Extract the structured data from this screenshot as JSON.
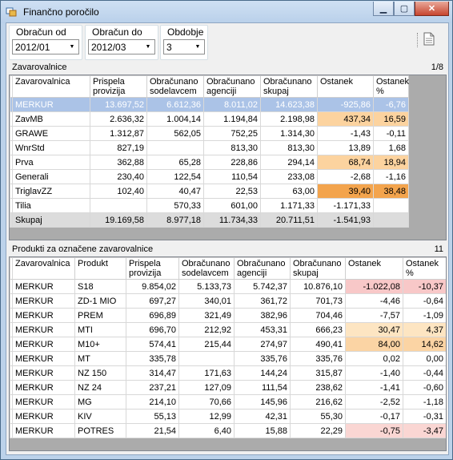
{
  "window": {
    "title": "Finančno poročilo"
  },
  "filters": {
    "obracun_od": {
      "label": "Obračun od",
      "value": "2012/01"
    },
    "obracun_do": {
      "label": "Obračun do",
      "value": "2012/03"
    },
    "obdobje": {
      "label": "Obdobje",
      "value": "3"
    }
  },
  "zavarovalnice": {
    "title": "Zavarovalnice",
    "pager": "1/8",
    "columns": [
      "Zavarovalnica",
      "Prispela provizija",
      "Obračunano sodelavcem",
      "Obračunano agenciji",
      "Obračunano skupaj",
      "Ostanek",
      "Ostanek %"
    ],
    "rows": [
      [
        "MERKUR",
        "13.697,52",
        "6.612,36",
        "8.011,02",
        "14.623,38",
        "-925,86",
        "-6,76"
      ],
      [
        "ZavMB",
        "2.636,32",
        "1.004,14",
        "1.194,84",
        "2.198,98",
        "437,34",
        "16,59"
      ],
      [
        "GRAWE",
        "1.312,87",
        "562,05",
        "752,25",
        "1.314,30",
        "-1,43",
        "-0,11"
      ],
      [
        "WnrStd",
        "827,19",
        "",
        "813,30",
        "813,30",
        "13,89",
        "1,68"
      ],
      [
        "Prva",
        "362,88",
        "65,28",
        "228,86",
        "294,14",
        "68,74",
        "18,94"
      ],
      [
        "Generali",
        "230,40",
        "122,54",
        "110,54",
        "233,08",
        "-2,68",
        "-1,16"
      ],
      [
        "TriglavZZ",
        "102,40",
        "40,47",
        "22,53",
        "63,00",
        "39,40",
        "38,48"
      ],
      [
        "Tilia",
        "",
        "570,33",
        "601,00",
        "1.171,33",
        "-1.171,33",
        ""
      ],
      [
        "Skupaj",
        "19.169,58",
        "8.977,18",
        "11.734,33",
        "20.711,51",
        "-1.541,93",
        ""
      ]
    ]
  },
  "produkti": {
    "title": "Produkti za označene zavarovalnice",
    "count": "11",
    "columns": [
      "Zavarovalnica",
      "Produkt",
      "Prispela provizija",
      "Obračunano sodelavcem",
      "Obračunano agenciji",
      "Obračunano skupaj",
      "Ostanek",
      "Ostanek %"
    ],
    "rows": [
      [
        "MERKUR",
        "S18",
        "9.854,02",
        "5.133,73",
        "5.742,37",
        "10.876,10",
        "-1.022,08",
        "-10,37"
      ],
      [
        "MERKUR",
        "ZD-1 MIO",
        "697,27",
        "340,01",
        "361,72",
        "701,73",
        "-4,46",
        "-0,64"
      ],
      [
        "MERKUR",
        "PREM",
        "696,89",
        "321,49",
        "382,96",
        "704,46",
        "-7,57",
        "-1,09"
      ],
      [
        "MERKUR",
        "MTI",
        "696,70",
        "212,92",
        "453,31",
        "666,23",
        "30,47",
        "4,37"
      ],
      [
        "MERKUR",
        "M10+",
        "574,41",
        "215,44",
        "274,97",
        "490,41",
        "84,00",
        "14,62"
      ],
      [
        "MERKUR",
        "MT",
        "335,78",
        "",
        "335,76",
        "335,76",
        "0,02",
        "0,00"
      ],
      [
        "MERKUR",
        "NZ 150",
        "314,47",
        "171,63",
        "144,24",
        "315,87",
        "-1,40",
        "-0,44"
      ],
      [
        "MERKUR",
        "NZ 24",
        "237,21",
        "127,09",
        "111,54",
        "238,62",
        "-1,41",
        "-0,60"
      ],
      [
        "MERKUR",
        "MG",
        "214,10",
        "70,66",
        "145,96",
        "216,62",
        "-2,52",
        "-1,18"
      ],
      [
        "MERKUR",
        "KIV",
        "55,13",
        "12,99",
        "42,31",
        "55,30",
        "-0,17",
        "-0,31"
      ],
      [
        "MERKUR",
        "POTRES",
        "21,54",
        "6,40",
        "15,88",
        "22,29",
        "-0,75",
        "-3,47"
      ]
    ]
  }
}
